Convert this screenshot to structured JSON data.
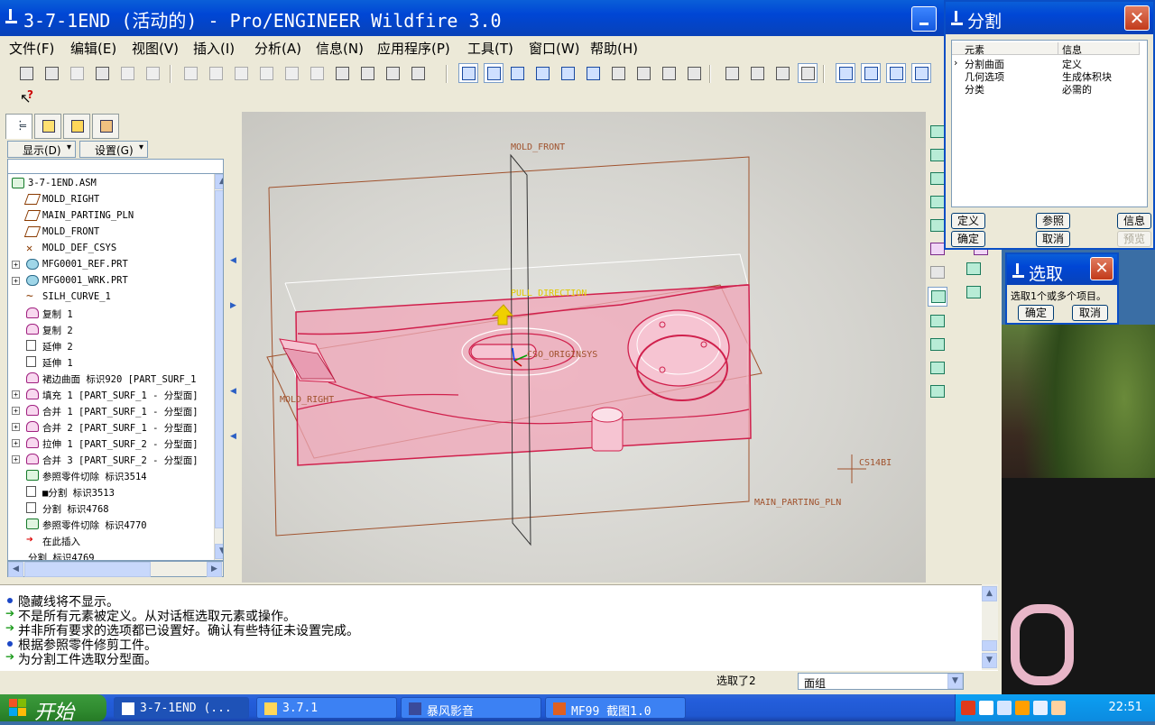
{
  "window": {
    "title": "3-7-1END (活动的) - Pro/ENGINEER Wildfire 3.0"
  },
  "menu": [
    "文件(F)",
    "编辑(E)",
    "视图(V)",
    "插入(I)",
    "分析(A)",
    "信息(N)",
    "应用程序(P)",
    "工具(T)",
    "窗口(W)",
    "帮助(H)"
  ],
  "toolbar": {
    "icons": [
      "new-file-icon",
      "open-file-icon",
      "save-icon",
      "print-icon",
      "send-mail-icon",
      "send-mail-2-icon",
      "undo-icon",
      "redo-icon",
      "cut-icon",
      "copy-icon",
      "paste-icon",
      "paste-special-icon",
      "regenerate-icon",
      "regen-manager-icon",
      "find-icon",
      "select-box-icon",
      "redraw-icon",
      "spin-center-icon",
      "orient-mode-icon",
      "zoom-in-icon",
      "zoom-out-icon",
      "refit-icon",
      "reorient-icon",
      "saved-views-icon",
      "layers-icon",
      "view-manager-icon",
      "wireframe-icon",
      "hidden-line-icon",
      "no-hidden-icon",
      "shading-icon",
      "datum-planes-icon",
      "datum-axes-icon",
      "datum-points-icon",
      "coord-systems-icon"
    ],
    "help_icon": "whats-this-icon"
  },
  "navigator": {
    "tabs": [
      "model-tree-tab",
      "folder-browser-tab",
      "favorites-tab",
      "connections-tab"
    ],
    "display_btn": "显示(D)",
    "settings_btn": "设置(G)",
    "tree": [
      {
        "label": "3-7-1END.ASM",
        "icon": "assembly-icon",
        "indent": 0,
        "expand": ""
      },
      {
        "label": "MOLD_RIGHT",
        "icon": "datum-plane-icon",
        "indent": 1,
        "expand": ""
      },
      {
        "label": "MAIN_PARTING_PLN",
        "icon": "datum-plane-icon",
        "indent": 1,
        "expand": ""
      },
      {
        "label": "MOLD_FRONT",
        "icon": "datum-plane-icon",
        "indent": 1,
        "expand": ""
      },
      {
        "label": "MOLD_DEF_CSYS",
        "icon": "csys-icon",
        "indent": 1,
        "expand": ""
      },
      {
        "label": "MFG0001_REF.PRT",
        "icon": "part-icon",
        "indent": 1,
        "expand": "+"
      },
      {
        "label": "MFG0001_WRK.PRT",
        "icon": "part-icon",
        "indent": 1,
        "expand": "+"
      },
      {
        "label": "SILH_CURVE_1",
        "icon": "curve-icon",
        "indent": 1,
        "expand": ""
      },
      {
        "label": "复制 1",
        "icon": "surface-icon",
        "indent": 1,
        "expand": ""
      },
      {
        "label": "复制 2",
        "icon": "surface-icon",
        "indent": 1,
        "expand": ""
      },
      {
        "label": "延伸 2",
        "icon": "extend-icon",
        "indent": 1,
        "expand": ""
      },
      {
        "label": "延伸 1",
        "icon": "extend-icon",
        "indent": 1,
        "expand": ""
      },
      {
        "label": "裙边曲面 标识920 [PART_SURF_1",
        "icon": "surface-icon",
        "indent": 1,
        "expand": ""
      },
      {
        "label": "填充 1 [PART_SURF_1 - 分型面]",
        "icon": "surface-icon",
        "indent": 1,
        "expand": "+"
      },
      {
        "label": "合并 1 [PART_SURF_1 - 分型面]",
        "icon": "surface-icon",
        "indent": 1,
        "expand": "+"
      },
      {
        "label": "合并 2 [PART_SURF_1 - 分型面]",
        "icon": "surface-icon",
        "indent": 1,
        "expand": "+"
      },
      {
        "label": "拉伸 1 [PART_SURF_2 - 分型面]",
        "icon": "surface-icon",
        "indent": 1,
        "expand": "+"
      },
      {
        "label": "合并 3 [PART_SURF_2 - 分型面]",
        "icon": "surface-icon",
        "indent": 1,
        "expand": "+"
      },
      {
        "label": "参照零件切除 标识3514",
        "icon": "ref-cut-icon",
        "indent": 1,
        "expand": ""
      },
      {
        "label": "■分割 标识3513",
        "icon": "split-icon",
        "indent": 1,
        "expand": ""
      },
      {
        "label": "分割 标识4768",
        "icon": "split-icon",
        "indent": 1,
        "expand": ""
      },
      {
        "label": "参照零件切除 标识4770",
        "icon": "ref-cut-icon",
        "indent": 1,
        "expand": ""
      },
      {
        "label": "在此插入",
        "icon": "insert-here-arrow-icon",
        "indent": 1,
        "expand": ""
      },
      {
        "label": "分割 标识4769",
        "icon": "",
        "indent": 0,
        "expand": ""
      }
    ]
  },
  "viewport": {
    "labels": {
      "mold_front": "MOLD_FRONT",
      "pull_direction": "PULL DIRECTION",
      "mold_right": "MOLD_RIGHT",
      "csys": "CSO_ORIGINSYS",
      "csys2": "CS14BI",
      "parting_plane": "MAIN_PARTING_PLN"
    },
    "colors": {
      "datum": "#a0522d",
      "surface": "#f0a6b8",
      "surface_edge": "#d0204c",
      "pull": "#f0d000"
    }
  },
  "right_toolbar": [
    "parting-surface-icon",
    "volume-split-icon",
    "mold-volume-icon",
    "extract-icon",
    "trim-icon",
    "draft-icon",
    "shadow-icon",
    "skirt-icon",
    "silhouette-curve-icon",
    "split-tool-icon",
    "merge-icon",
    "offset-icon",
    "mold-opening-icon",
    "datum-csys-icon",
    "datum-point-icon"
  ],
  "messages": [
    {
      "type": "bullet",
      "text": "隐藏线将不显示。"
    },
    {
      "type": "arrow",
      "text": "不是所有元素被定义。从对话框选取元素或操作。"
    },
    {
      "type": "arrow",
      "text": "并非所有要求的选项都已设置好。确认有些特征未设置完成。"
    },
    {
      "type": "bullet",
      "text": "根据参照零件修剪工件。"
    },
    {
      "type": "arrow",
      "text": "为分割工件选取分型面。"
    }
  ],
  "status": {
    "selected": "选取了2",
    "filter": "面组"
  },
  "split_dialog": {
    "title": "分割",
    "col_element": "元素",
    "col_info": "信息",
    "rows": [
      {
        "element": "分割曲面",
        "info": "定义"
      },
      {
        "element": "几何选项",
        "info": "生成体积块"
      },
      {
        "element": "分类",
        "info": "必需的"
      }
    ],
    "buttons": {
      "define": "定义",
      "refs": "参照",
      "info": "信息",
      "ok": "确定",
      "cancel": "取消",
      "preview": "预览"
    }
  },
  "select_dialog": {
    "title": "选取",
    "prompt": "选取1个或多个项目。",
    "ok": "确定",
    "cancel": "取消"
  },
  "taskbar": {
    "start": "开始",
    "tasks": [
      {
        "label": "3-7-1END (...",
        "icon": "proe-icon",
        "active": true
      },
      {
        "label": "3.7.1",
        "icon": "folder-icon",
        "active": false
      },
      {
        "label": "暴风影音",
        "icon": "media-player-icon",
        "active": false
      },
      {
        "label": "MF99  截图1.0",
        "icon": "screenshot-tool-icon",
        "active": false
      }
    ],
    "clock": "22:51"
  }
}
